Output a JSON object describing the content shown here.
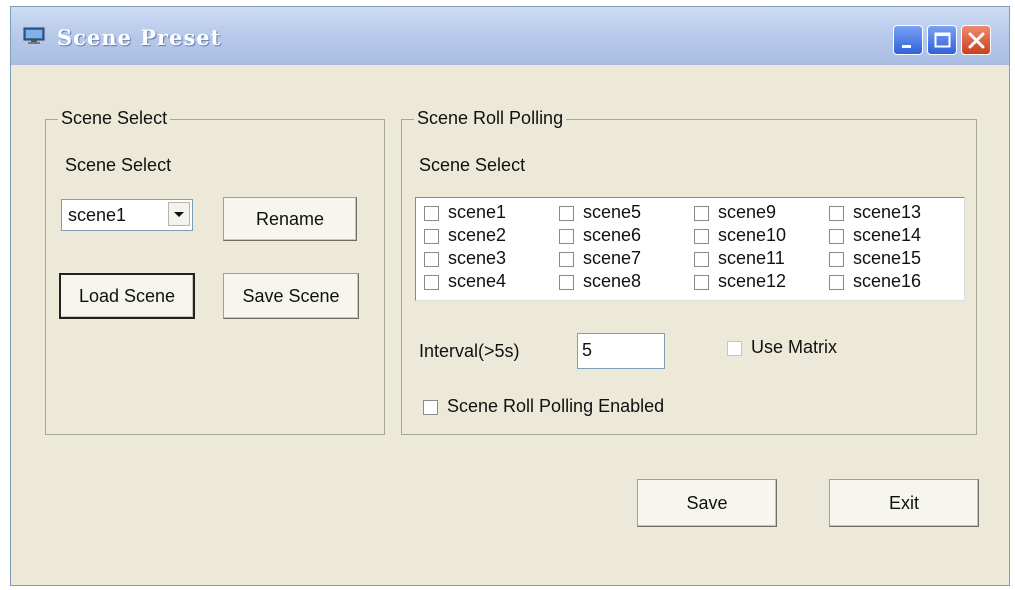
{
  "window": {
    "title": "Scene Preset",
    "icon": "monitor-icon"
  },
  "titlebar_buttons": [
    "minimize-icon",
    "maximize-icon",
    "close-icon"
  ],
  "scene_select_group": {
    "legend": "Scene Select",
    "label": "Scene Select",
    "combo_value": "scene1",
    "rename_label": "Rename",
    "load_label": "Load Scene",
    "save_scene_label": "Save Scene"
  },
  "roll_polling_group": {
    "legend": "Scene Roll Polling",
    "scene_select_label": "Scene Select",
    "scenes": [
      {
        "label": "scene1",
        "checked": false
      },
      {
        "label": "scene2",
        "checked": false
      },
      {
        "label": "scene3",
        "checked": false
      },
      {
        "label": "scene4",
        "checked": false
      },
      {
        "label": "scene5",
        "checked": false
      },
      {
        "label": "scene6",
        "checked": false
      },
      {
        "label": "scene7",
        "checked": false
      },
      {
        "label": "scene8",
        "checked": false
      },
      {
        "label": "scene9",
        "checked": false
      },
      {
        "label": "scene10",
        "checked": false
      },
      {
        "label": "scene11",
        "checked": false
      },
      {
        "label": "scene12",
        "checked": false
      },
      {
        "label": "scene13",
        "checked": false
      },
      {
        "label": "scene14",
        "checked": false
      },
      {
        "label": "scene15",
        "checked": false
      },
      {
        "label": "scene16",
        "checked": false
      }
    ],
    "interval_label": "Interval(>5s)",
    "interval_value": "5",
    "use_matrix_label": "Use Matrix",
    "use_matrix_enabled": false,
    "enabled_label": "Scene Roll Polling Enabled",
    "enabled_checked": false
  },
  "footer": {
    "save_label": "Save",
    "exit_label": "Exit"
  }
}
